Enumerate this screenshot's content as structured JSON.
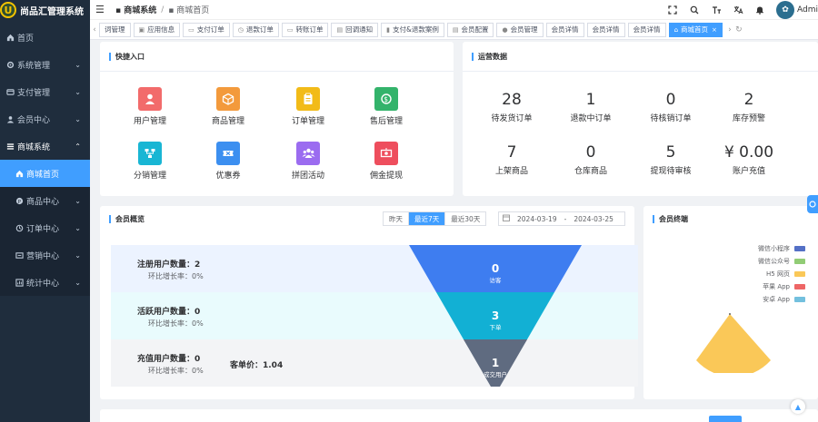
{
  "app": {
    "title": "尚品汇管理系统",
    "logo_letter": "U"
  },
  "sidebar": {
    "items": [
      {
        "label": "首页",
        "icon": "home-icon",
        "arrow": false
      },
      {
        "label": "系统管理",
        "icon": "gear-icon",
        "arrow": true
      },
      {
        "label": "支付管理",
        "icon": "card-icon",
        "arrow": true
      },
      {
        "label": "会员中心",
        "icon": "user-icon",
        "arrow": true
      },
      {
        "label": "商城系统",
        "icon": "shop-icon",
        "arrow": true,
        "open": true
      }
    ],
    "sub_items": [
      {
        "label": "商城首页",
        "icon": "home-icon",
        "active": true,
        "arrow": false
      },
      {
        "label": "商品中心",
        "icon": "goods-icon",
        "arrow": true
      },
      {
        "label": "订单中心",
        "icon": "order-icon",
        "arrow": true
      },
      {
        "label": "营销中心",
        "icon": "marketing-icon",
        "arrow": true
      },
      {
        "label": "统计中心",
        "icon": "chart-icon",
        "arrow": true
      }
    ]
  },
  "header": {
    "breadcrumb_root": "商城系统",
    "breadcrumb_sep": "/",
    "breadcrumb_current": "商城首页",
    "admin": "Admi",
    "icons": [
      "fullscreen-icon",
      "search-icon",
      "font-size-icon",
      "translate-icon",
      "bell-icon"
    ]
  },
  "tabs": [
    {
      "label": "词管理",
      "icon": ""
    },
    {
      "label": "应用信息",
      "icon": "app-icon"
    },
    {
      "label": "支付订单",
      "icon": "pay-icon"
    },
    {
      "label": "退款订单",
      "icon": "refund-icon"
    },
    {
      "label": "转账订单",
      "icon": "transfer-icon"
    },
    {
      "label": "回调通知",
      "icon": "callback-icon"
    },
    {
      "label": "支付&退款案例",
      "icon": "case-icon"
    },
    {
      "label": "会员配置",
      "icon": "config-icon"
    },
    {
      "label": "会员管理",
      "icon": "member-icon"
    },
    {
      "label": "会员详情",
      "icon": ""
    },
    {
      "label": "会员详情",
      "icon": ""
    },
    {
      "label": "会员详情",
      "icon": ""
    },
    {
      "label": "商城首页",
      "icon": "home-icon",
      "active": true
    }
  ],
  "quick_entry": {
    "title": "快捷入口",
    "items": [
      {
        "label": "用户管理",
        "color": "#f26b6b",
        "icon": "user-icon"
      },
      {
        "label": "商品管理",
        "color": "#f39a3c",
        "icon": "box-icon"
      },
      {
        "label": "订单管理",
        "color": "#f2bb18",
        "icon": "clipboard-icon"
      },
      {
        "label": "售后管理",
        "color": "#33b36b",
        "icon": "money-icon"
      },
      {
        "label": "分销管理",
        "color": "#19b6d4",
        "icon": "share-icon"
      },
      {
        "label": "优惠券",
        "color": "#3c8ff0",
        "icon": "ticket-icon"
      },
      {
        "label": "拼团活动",
        "color": "#9b6cf0",
        "icon": "group-icon"
      },
      {
        "label": "佣金提现",
        "color": "#ee4e5d",
        "icon": "cash-icon"
      }
    ]
  },
  "ops": {
    "title": "运营数据",
    "items": [
      {
        "value": "28",
        "label": "待发货订单"
      },
      {
        "value": "1",
        "label": "退款中订单"
      },
      {
        "value": "0",
        "label": "待核销订单"
      },
      {
        "value": "2",
        "label": "库存预警"
      },
      {
        "value": "7",
        "label": "上架商品"
      },
      {
        "value": "0",
        "label": "仓库商品"
      },
      {
        "value": "5",
        "label": "提现待审核"
      },
      {
        "value": "¥ 0.00",
        "label": "账户充值"
      }
    ]
  },
  "member_overview": {
    "title": "会员概览",
    "ranges": [
      {
        "label": "昨天",
        "on": false
      },
      {
        "label": "最近7天",
        "on": true
      },
      {
        "label": "最近30天",
        "on": false
      }
    ],
    "date_start": "2024-03-19",
    "date_sep": "-",
    "date_end": "2024-03-25",
    "rows": [
      {
        "main": "注册用户数量：2",
        "sub": "环比增长率：0%"
      },
      {
        "main": "活跃用户数量：0",
        "sub": "环比增长率：0%"
      },
      {
        "main": "充值用户数量：0",
        "sub": "环比增长率：0%"
      }
    ],
    "avg_price": "客单价：1.04",
    "funnel": [
      {
        "value": "0",
        "label": "访客",
        "color": "#3e7df0"
      },
      {
        "value": "3",
        "label": "下单",
        "color": "#12b0d4"
      },
      {
        "value": "1",
        "label": "成交用户",
        "color": "#5f6b80"
      }
    ]
  },
  "member_terminal": {
    "title": "会员终端",
    "legend": [
      {
        "name": "微信小程序",
        "color": "#5470c6"
      },
      {
        "name": "微信公众号",
        "color": "#91cc75"
      },
      {
        "name": "H5 网页",
        "color": "#fac858"
      },
      {
        "name": "苹果 App",
        "color": "#ee6666"
      },
      {
        "name": "安卓 App",
        "color": "#73c0de"
      }
    ],
    "pie_color": "#fac858"
  }
}
